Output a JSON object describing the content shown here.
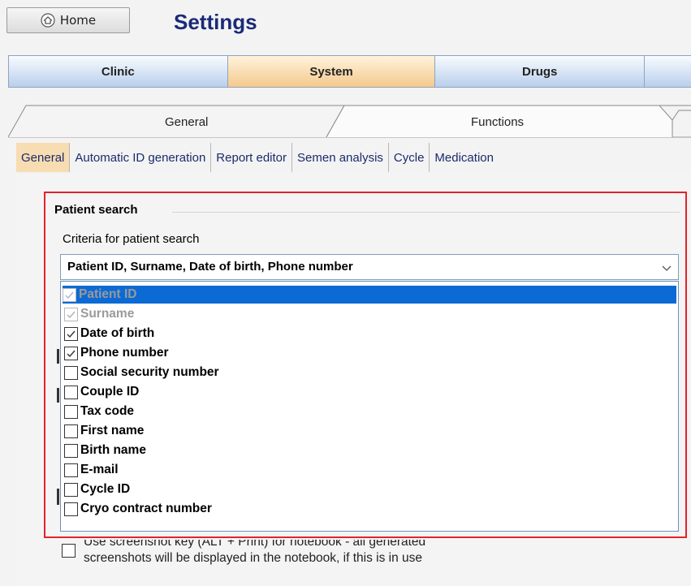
{
  "header": {
    "home_label": "Home",
    "title": "Settings"
  },
  "main_tabs": [
    {
      "label": "Clinic",
      "active": false
    },
    {
      "label": "System",
      "active": true
    },
    {
      "label": "Drugs",
      "active": false
    }
  ],
  "sub_tabs": [
    {
      "label": "General",
      "active": false
    },
    {
      "label": "Functions",
      "active": true
    }
  ],
  "subsub_tabs": [
    {
      "label": "General",
      "active": true
    },
    {
      "label": "Automatic ID generation",
      "active": false
    },
    {
      "label": "Report editor",
      "active": false
    },
    {
      "label": "Semen analysis",
      "active": false
    },
    {
      "label": "Cycle",
      "active": false
    },
    {
      "label": "Medication",
      "active": false
    }
  ],
  "patient_search": {
    "group_title": "Patient search",
    "criteria_label": "Criteria for patient search",
    "selected_value": "Patient ID, Surname, Date of birth, Phone number",
    "options": [
      {
        "label": "Patient ID",
        "checked": true,
        "disabled": true,
        "highlighted": true
      },
      {
        "label": "Surname",
        "checked": true,
        "disabled": true,
        "highlighted": false
      },
      {
        "label": "Date of birth",
        "checked": true,
        "disabled": false,
        "highlighted": false
      },
      {
        "label": "Phone number",
        "checked": true,
        "disabled": false,
        "highlighted": false
      },
      {
        "label": "Social security number",
        "checked": false,
        "disabled": false,
        "highlighted": false
      },
      {
        "label": "Couple ID",
        "checked": false,
        "disabled": false,
        "highlighted": false
      },
      {
        "label": "Tax code",
        "checked": false,
        "disabled": false,
        "highlighted": false
      },
      {
        "label": "First name",
        "checked": false,
        "disabled": false,
        "highlighted": false
      },
      {
        "label": "Birth name",
        "checked": false,
        "disabled": false,
        "highlighted": false
      },
      {
        "label": "E-mail",
        "checked": false,
        "disabled": false,
        "highlighted": false
      },
      {
        "label": "Cycle ID",
        "checked": false,
        "disabled": false,
        "highlighted": false
      },
      {
        "label": "Cryo contract number",
        "checked": false,
        "disabled": false,
        "highlighted": false
      }
    ]
  },
  "notebook_option": {
    "line1": "Use screenshot key (ALT + Print) for notebook - all generated",
    "line2": "screenshots will be displayed in the notebook, if this is in use",
    "checked": false
  },
  "colors": {
    "title": "#1b2a77",
    "active_tab": "#f4c98c",
    "highlight_border": "#e2232a",
    "selected_item": "#0c6ad4"
  }
}
